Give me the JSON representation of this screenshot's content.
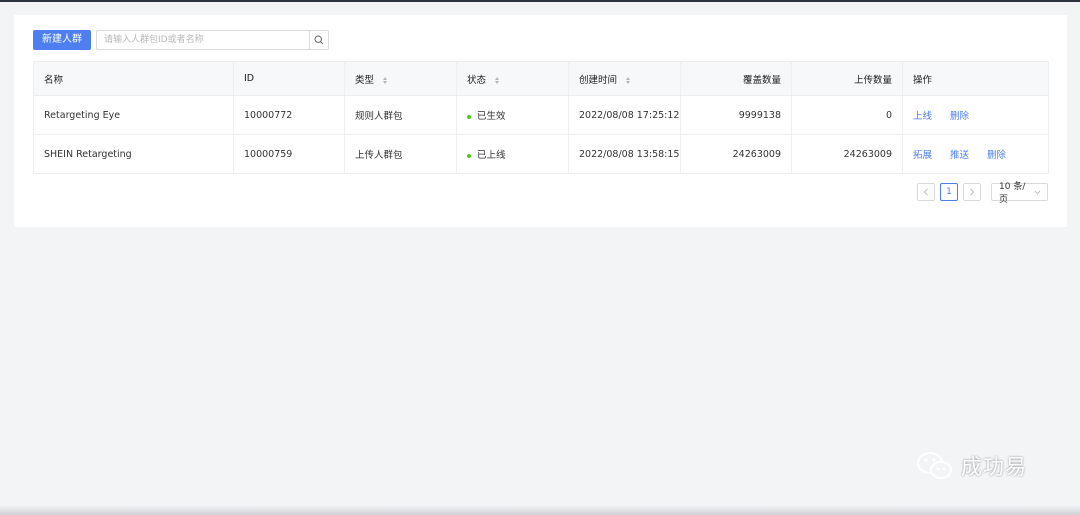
{
  "toolbar": {
    "new_button": "新建人群",
    "search_placeholder": "请输入人群包ID或者名称"
  },
  "table": {
    "headers": {
      "name": "名称",
      "id": "ID",
      "type": "类型",
      "status": "状态",
      "created": "创建时间",
      "coverage": "覆盖数量",
      "uploaded": "上传数量",
      "actions": "操作"
    },
    "rows": [
      {
        "name": "Retargeting Eye",
        "id": "10000772",
        "type": "规则人群包",
        "status": "已生效",
        "created": "2022/08/08 17:25:12",
        "coverage": "9999138",
        "uploaded": "0",
        "actions": [
          "上线",
          "删除"
        ]
      },
      {
        "name": "SHEIN Retargeting",
        "id": "10000759",
        "type": "上传人群包",
        "status": "已上线",
        "created": "2022/08/08 13:58:15",
        "coverage": "24263009",
        "uploaded": "24263009",
        "actions": [
          "拓展",
          "推送",
          "删除"
        ]
      }
    ]
  },
  "pagination": {
    "current_page": "1",
    "page_size": "10 条/页"
  },
  "watermark": {
    "text": "成功易",
    "icon": "wechat-icon"
  },
  "colors": {
    "primary": "#4d7ff0",
    "status_dot": "#52c41a",
    "background": "#f3f4f6"
  }
}
